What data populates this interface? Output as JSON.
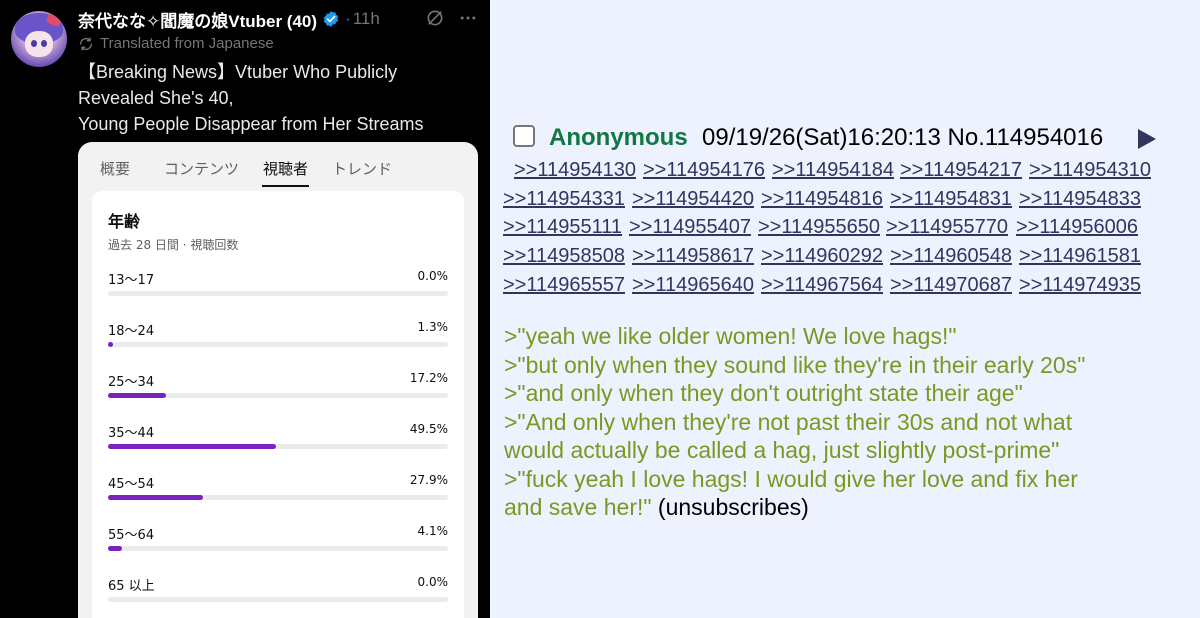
{
  "post": {
    "display_name": "奈代なな✧閻魔の娘Vtuber (40)",
    "time": "11h",
    "translated_label": "Translated from Japanese",
    "text_lines": [
      "【Breaking News】Vtuber Who Publicly",
      "Revealed She's 40,",
      "Young People Disappear from Her Streams"
    ],
    "verified_color": "#1d9bf0"
  },
  "analytics": {
    "tabs": [
      "概要",
      "コンテンツ",
      "視聴者",
      "トレンド"
    ],
    "active_tab": "視聴者",
    "title": "年齢",
    "subtitle": "過去 28 日間 · 視聴回数",
    "bar_color": "#7a22c0",
    "rows": [
      {
        "label": "13〜17",
        "percent": "0.0%",
        "value": 0.0
      },
      {
        "label": "18〜24",
        "percent": "1.3%",
        "value": 1.3
      },
      {
        "label": "25〜34",
        "percent": "17.2%",
        "value": 17.2
      },
      {
        "label": "35〜44",
        "percent": "49.5%",
        "value": 49.5
      },
      {
        "label": "45〜54",
        "percent": "27.9%",
        "value": 27.9
      },
      {
        "label": "55〜64",
        "percent": "4.1%",
        "value": 4.1
      },
      {
        "label": "65 以上",
        "percent": "0.0%",
        "value": 0.0
      }
    ]
  },
  "board_post": {
    "name": "Anonymous",
    "datetime": "09/19/26(Sat)16:20:13",
    "post_no": "No.114954016",
    "reply_rows": [
      [
        ">>114954130",
        ">>114954176",
        ">>114954184",
        ">>114954217",
        ">>114954310"
      ],
      [
        ">>114954331",
        ">>114954420",
        ">>114954816",
        ">>114954831",
        ">>114954833"
      ],
      [
        ">>114955111",
        ">>114955407",
        ">>114955650",
        ">>114955770",
        ">>114956006"
      ],
      [
        ">>114958508",
        ">>114958617",
        ">>114960292",
        ">>114960548",
        ">>114961581"
      ],
      [
        ">>114965557",
        ">>114965640",
        ">>114967564",
        ">>114970687",
        ">>114974935"
      ]
    ],
    "greentext": [
      ">\"yeah we like older women! We love hags!\"",
      ">\"but only when they sound like they're in their early 20s\"",
      ">\"and only when they don't outright state their age\"",
      ">\"And only when they're not past their 30s and not what",
      "would actually be called a hag, just slightly post-prime\"",
      ">\"fuck yeah I love hags! I would give her love and fix her",
      "and save her!\""
    ],
    "trailing_text": " (unsubscribes)",
    "name_color": "#117743",
    "greentext_color": "#789922",
    "link_color": "#34345c"
  }
}
